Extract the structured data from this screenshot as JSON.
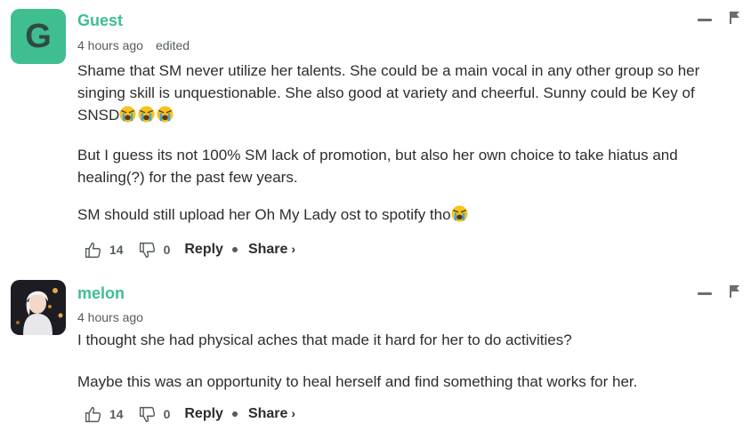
{
  "comments": [
    {
      "avatar_letter": "G",
      "avatar_color": "#3fbe8f",
      "author": "Guest",
      "time": "4 hours ago",
      "edited": "edited",
      "paragraphs": [
        "Shame that SM never utilize her talents. She could be a main vocal in any other group so her singing skill is unquestionable. She also good at variety and cheerful. Sunny could be Key of SNSD",
        "But I guess its not 100% SM lack of promotion, but also her own choice to take hiatus and healing(?) for the past few years.",
        "SM should still upload her Oh My Lady ost to spotify tho"
      ],
      "upvotes": "14",
      "downvotes": "0",
      "reply_label": "Reply",
      "share_label": "Share",
      "share_chevron": "›"
    },
    {
      "author": "melon",
      "time": "4 hours ago",
      "paragraphs": [
        "I thought she had physical aches that made it hard for her to do activities?",
        "Maybe this was an opportunity to heal herself and find something that works for her."
      ],
      "upvotes": "14",
      "downvotes": "0",
      "reply_label": "Reply",
      "share_label": "Share",
      "share_chevron": "›"
    }
  ],
  "icons": {
    "upvote": "thumbs-up-icon",
    "downvote": "thumbs-down-icon",
    "collapse": "minus-icon",
    "report": "flag-icon",
    "emoji": "loudly-crying-face-emoji"
  },
  "colors": {
    "accent": "#3fbe8f",
    "text": "#2a2e2e",
    "muted": "#545c5c"
  }
}
